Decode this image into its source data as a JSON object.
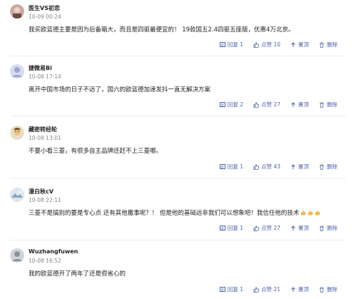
{
  "comments": [
    {
      "user": "医生VS初恋",
      "time": "10-09 00:24",
      "content": "我买欧蓝德主要是因为后备箱大，而且是四驱最便宜的！ 19款国五2.4四驱五座版，优惠4万北京。",
      "reply": "回复 1",
      "like": "点赞 10",
      "top": "置顶",
      "delete": "删除"
    },
    {
      "user": "捷微易Bi",
      "time": "10-08 17:14",
      "content": "离开中国市场的日子不远了，国六的欧蓝德加速发抖一直无解决方案",
      "reply": "回复 2",
      "like": "点赞 27",
      "top": "置顶",
      "delete": "删除"
    },
    {
      "user": "藏密转经轮",
      "time": "10-08 13:01",
      "content": "不要小看三菱，有很多自主品牌还赶不上三菱哪。",
      "reply": "回复 1",
      "like": "点赞 43",
      "top": "置顶",
      "delete": "删除"
    },
    {
      "user": "漫白秋cV",
      "time": "10-08 22:11",
      "content": "三菱不是搞别的要是专心点 还有其他撒事呢？！ 但是他的基础远非我们可以想象吧！我信任他的技术",
      "reply": "回复 1",
      "like": "点赞 27",
      "top": "置顶",
      "delete": "删除"
    },
    {
      "user": "Wuzhangfuwen",
      "time": "10-08 16:52",
      "content": "我的欧蓝德开了两年了还是很省心的",
      "reply": "回复 1",
      "like": "点赞 21",
      "top": "置顶",
      "delete": "删除"
    }
  ],
  "colors": {
    "accent": "#4a63b0",
    "muted": "#888888",
    "divider": "#ececec"
  }
}
